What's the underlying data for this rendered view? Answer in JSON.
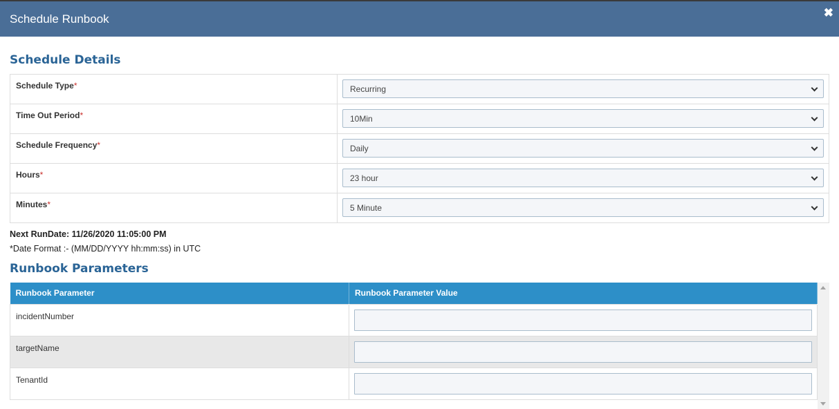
{
  "modal": {
    "title": "Schedule Runbook",
    "close_icon": "close-icon"
  },
  "schedule_details": {
    "heading": "Schedule Details",
    "rows": [
      {
        "label": "Schedule Type",
        "value": "Recurring"
      },
      {
        "label": "Time Out Period",
        "value": "10Min"
      },
      {
        "label": "Schedule Frequency",
        "value": "Daily"
      },
      {
        "label": "Hours",
        "value": "23 hour"
      },
      {
        "label": "Minutes",
        "value": "5 Minute"
      }
    ],
    "required_marker": "*"
  },
  "next_run": "Next RunDate: 11/26/2020 11:05:00 PM",
  "date_format": "*Date Format :- (MM/DD/YYYY hh:mm:ss) in UTC",
  "runbook_parameters": {
    "heading": "Runbook Parameters",
    "columns": [
      "Runbook Parameter",
      "Runbook Parameter Value"
    ],
    "rows": [
      {
        "name": "incidentNumber",
        "value": ""
      },
      {
        "name": "targetName",
        "value": ""
      },
      {
        "name": "TenantId",
        "value": ""
      }
    ]
  },
  "colors": {
    "header_bg": "#4a6e97",
    "section_title": "#2a6496",
    "table_header_bg": "#2d8fc8",
    "required": "#c9302c"
  }
}
